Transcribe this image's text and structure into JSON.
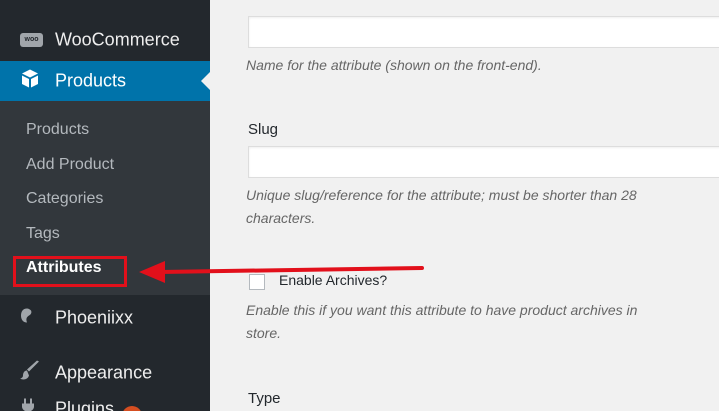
{
  "sidebar": {
    "woocommerce": {
      "label": "WooCommerce",
      "icon": "woo-logo-icon",
      "badge_text": "woo"
    },
    "products": {
      "label": "Products",
      "icon": "box-icon"
    },
    "submenu": [
      {
        "label": "Products",
        "current": false
      },
      {
        "label": "Add Product",
        "current": false
      },
      {
        "label": "Categories",
        "current": false
      },
      {
        "label": "Tags",
        "current": false
      },
      {
        "label": "Attributes",
        "current": true
      }
    ],
    "phoeniixx": {
      "label": "Phoeniixx",
      "icon": "phoeniixx-icon"
    },
    "appearance": {
      "label": "Appearance",
      "icon": "paintbrush-icon"
    },
    "plugins": {
      "label": "Plugins",
      "icon": "plugin-icon"
    }
  },
  "form": {
    "name_description": "Name for the attribute (shown on the front-end).",
    "slug_label": "Slug",
    "slug_description_line1": "Unique slug/reference for the attribute; must be shorter than 28",
    "slug_description_line2": "characters.",
    "enable_archives_label": "Enable Archives?",
    "enable_archives_checked": false,
    "archives_description_line1": "Enable this if you want this attribute to have product archives in",
    "archives_description_line2": "store.",
    "type_label": "Type"
  },
  "annotation": {
    "color": "#e2101b"
  },
  "colors": {
    "sidebar_bg": "#23282d",
    "submenu_bg": "#32373c",
    "active_bg": "#0073aa",
    "content_bg": "#f1f1f1"
  }
}
